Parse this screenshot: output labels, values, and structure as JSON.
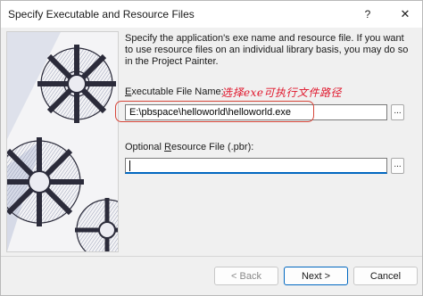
{
  "window": {
    "title": "Specify Executable and Resource Files",
    "help_label": "?",
    "close_label": "✕"
  },
  "description": "Specify the application's exe name and resource file.  If you want to use resource files on an individual library basis, you may do so in the Project Painter.",
  "executable": {
    "label_accel": "E",
    "label_rest": "xecutable File Name:",
    "annotation": "选择exe可执行文件路径",
    "value": "E:\\pbspace\\helloworld\\helloworld.exe",
    "browse_label": "..."
  },
  "resource": {
    "label_pre": "Optional ",
    "label_accel": "R",
    "label_rest": "esource File (.pbr):",
    "value": "",
    "browse_label": "..."
  },
  "buttons": {
    "back": "< Back",
    "next": "Next >",
    "cancel": "Cancel"
  },
  "colors": {
    "annotation": "#e0162b",
    "focus_accent": "#0067c0"
  }
}
